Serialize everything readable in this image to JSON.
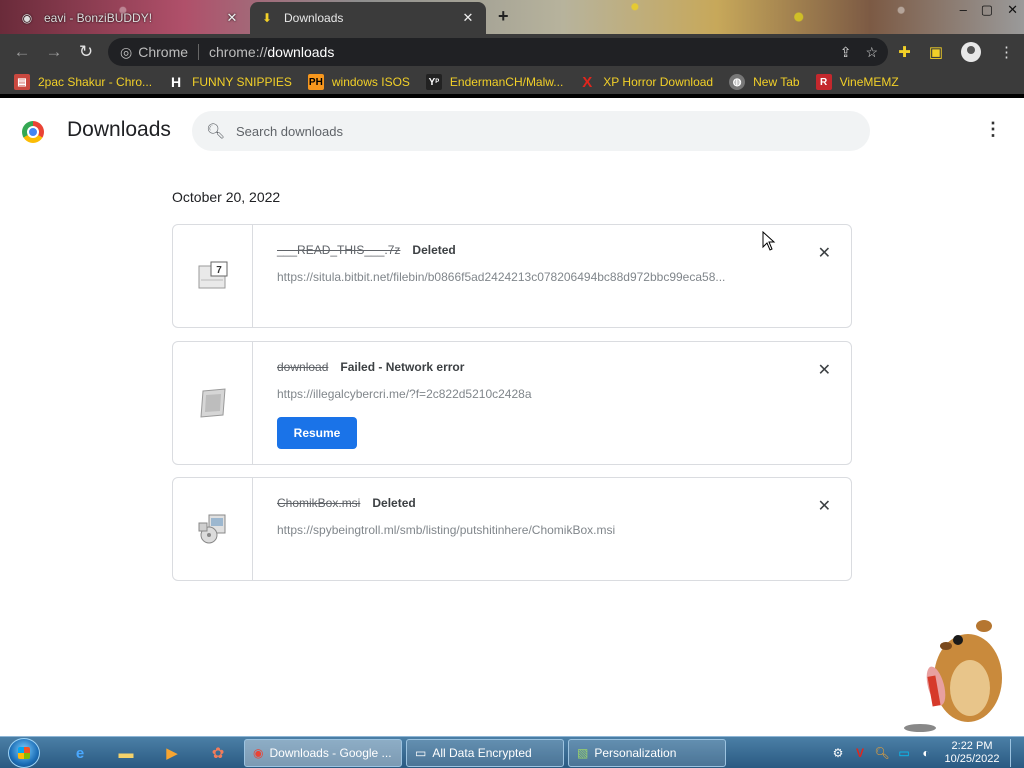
{
  "window": {
    "tabs": [
      {
        "title": "eavi - BonziBUDDY!",
        "active": false
      },
      {
        "title": "Downloads",
        "active": true
      }
    ],
    "new_tab_symbol": "+",
    "controls": {
      "minimize": "–",
      "maximize": "▢",
      "close": "✕"
    }
  },
  "toolbar": {
    "omnibox_chip": "Chrome",
    "url_scheme": "chrome://",
    "url_host": "downloads"
  },
  "bookmarks": [
    {
      "label": "2pac Shakur - Chro...",
      "icon": "bookmark-gift-icon",
      "color": "#c9483f"
    },
    {
      "label": "FUNNY SNIPPIES",
      "icon": "H",
      "color": "#ffffff"
    },
    {
      "label": "windows ISOS",
      "icon": "PH",
      "color": "#f7971d"
    },
    {
      "label": "EndermanCH/Malw...",
      "icon": "YP",
      "color": "#222222"
    },
    {
      "label": "XP Horror Download",
      "icon": "X",
      "color": "#e0261d"
    },
    {
      "label": "New Tab",
      "icon": "globe",
      "color": "#888888"
    },
    {
      "label": "VineMEMZ",
      "icon": "R",
      "color": "#c4282d"
    }
  ],
  "page": {
    "title": "Downloads",
    "search_placeholder": "Search downloads",
    "date": "October 20, 2022"
  },
  "downloads": [
    {
      "filename": "___READ_THIS___.7z",
      "status": "Deleted",
      "url": "https://situla.bitbit.net/filebin/b0866f5ad2424213c078206494bc88d972bbc99eca58...",
      "icon": "7z-archive-icon",
      "action": ""
    },
    {
      "filename": "download",
      "status": "Failed - Network error",
      "url": "https://illegalcybercri.me/?f=2c822d5210c2428a",
      "icon": "generic-file-icon",
      "action": "Resume"
    },
    {
      "filename": "ChomikBox.msi",
      "status": "Deleted",
      "url": "https://spybeingtroll.ml/smb/listing/putshitinhere/ChomikBox.msi",
      "icon": "msi-installer-icon",
      "action": ""
    }
  ],
  "taskbar": {
    "tasks": [
      {
        "label": "Downloads - Google ...",
        "active": true
      },
      {
        "label": "All Data Encrypted",
        "active": false
      },
      {
        "label": "Personalization",
        "active": false
      }
    ],
    "clock_time": "2:22 PM",
    "clock_date": "10/25/2022"
  },
  "colors": {
    "bookmark_text": "#f2d028",
    "resume_button": "#1a73e8",
    "chrome_dark": "#3b3b3b"
  }
}
